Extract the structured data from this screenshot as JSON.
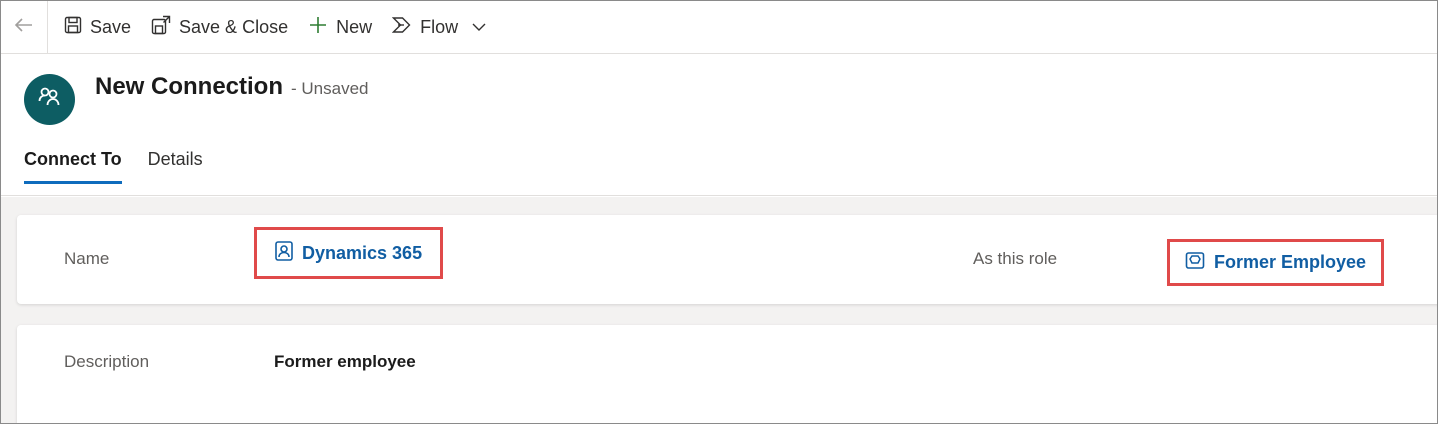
{
  "toolbar": {
    "save_label": "Save",
    "save_close_label": "Save & Close",
    "new_label": "New",
    "flow_label": "Flow"
  },
  "header": {
    "title": "New Connection",
    "status": "- Unsaved"
  },
  "tabs": [
    {
      "label": "Connect To",
      "active": true
    },
    {
      "label": "Details",
      "active": false
    }
  ],
  "form": {
    "name_label": "Name",
    "name_value": "Dynamics 365",
    "role_label": "As this role",
    "role_value": "Former Employee",
    "description_label": "Description",
    "description_value": "Former employee"
  },
  "colors": {
    "accent": "#0f6cbd",
    "link": "#115ea3",
    "avatar_bg": "#0d5d63",
    "highlight_border": "#e04a4a"
  },
  "icons": {
    "back": "back-arrow-icon",
    "save": "save-icon",
    "save_close": "save-close-icon",
    "new": "plus-icon",
    "flow": "flow-icon",
    "chevron": "chevron-down-icon",
    "entity": "connection-icon",
    "contact": "contact-icon",
    "role": "role-icon"
  }
}
